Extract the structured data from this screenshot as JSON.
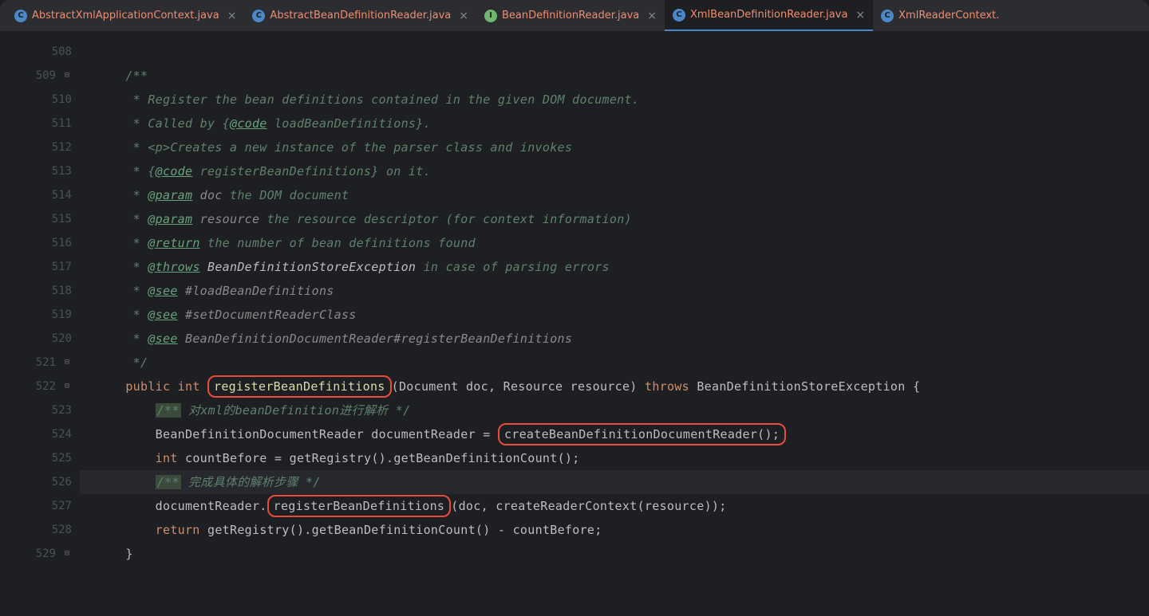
{
  "tabs": [
    {
      "icon": "C",
      "iconClass": "c",
      "label": "AbstractXmlApplicationContext.java",
      "active": false
    },
    {
      "icon": "C",
      "iconClass": "c",
      "label": "AbstractBeanDefinitionReader.java",
      "active": false
    },
    {
      "icon": "I",
      "iconClass": "i",
      "label": "BeanDefinitionReader.java",
      "active": false
    },
    {
      "icon": "C",
      "iconClass": "c",
      "label": "XmlBeanDefinitionReader.java",
      "active": true
    },
    {
      "icon": "C",
      "iconClass": "c",
      "label": "XmlReaderContext.",
      "active": false
    }
  ],
  "lineStart": 508,
  "lines": [
    {
      "n": 508,
      "content": ""
    },
    {
      "n": 509,
      "fold": "down",
      "content": "/**"
    },
    {
      "n": 510,
      "content": " * Register the bean definitions contained in the given DOM document."
    },
    {
      "n": 511,
      "content": " * Called by {@code loadBeanDefinitions}."
    },
    {
      "n": 512,
      "content": " * <p>Creates a new instance of the parser class and invokes"
    },
    {
      "n": 513,
      "content": " * {@code registerBeanDefinitions} on it."
    },
    {
      "n": 514,
      "content": " * @param doc the DOM document"
    },
    {
      "n": 515,
      "content": " * @param resource the resource descriptor (for context information)"
    },
    {
      "n": 516,
      "content": " * @return the number of bean definitions found"
    },
    {
      "n": 517,
      "content": " * @throws BeanDefinitionStoreException in case of parsing errors"
    },
    {
      "n": 518,
      "content": " * @see #loadBeanDefinitions"
    },
    {
      "n": 519,
      "content": " * @see #setDocumentReaderClass"
    },
    {
      "n": 520,
      "content": " * @see BeanDefinitionDocumentReader#registerBeanDefinitions"
    },
    {
      "n": 521,
      "fold": "up",
      "content": " */"
    },
    {
      "n": 522,
      "fold": "down",
      "content": "public int registerBeanDefinitions(Document doc, Resource resource) throws BeanDefinitionStoreException {"
    },
    {
      "n": 523,
      "content": "/** 对xml的beanDefinition进行解析 */"
    },
    {
      "n": 524,
      "content": "BeanDefinitionDocumentReader documentReader = createBeanDefinitionDocumentReader();"
    },
    {
      "n": 525,
      "content": "int countBefore = getRegistry().getBeanDefinitionCount();"
    },
    {
      "n": 526,
      "highlighted": true,
      "content": "/** 完成具体的解析步骤 */"
    },
    {
      "n": 527,
      "content": "documentReader.registerBeanDefinitions(doc, createReaderContext(resource));"
    },
    {
      "n": 528,
      "content": "return getRegistry().getBeanDefinitionCount() - countBefore;"
    },
    {
      "n": 529,
      "fold": "up",
      "content": "}"
    }
  ],
  "highlightedBoxes": [
    "registerBeanDefinitions",
    "createBeanDefinitionDocumentReader();",
    "registerBeanDefinitions"
  ],
  "comments": {
    "c523": "对xml的beanDefinition进行解析",
    "c526": "完成具体的解析步骤"
  },
  "javadoc": {
    "l510": "Register the bean definitions contained in the given DOM document.",
    "l511a": "Called by ",
    "l511b": "@code",
    "l511c": " loadBeanDefinitions",
    "l512": "<p>Creates a new instance of the parser class and invokes",
    "l513a": "@code",
    "l513b": " registerBeanDefinitions",
    "l513c": " on it.",
    "l514a": "@param",
    "l514b": "doc",
    "l514c": " the DOM document",
    "l515a": "@param",
    "l515b": "resource",
    "l515c": " the resource descriptor (for context information)",
    "l516a": "@return",
    "l516b": " the number of bean definitions found",
    "l517a": "@throws",
    "l517b": "BeanDefinitionStoreException",
    "l517c": " in case of parsing errors",
    "l518a": "@see",
    "l518b": " #loadBeanDefinitions",
    "l519a": "@see",
    "l519b": " #setDocumentReaderClass",
    "l520a": "@see",
    "l520b": " BeanDefinitionDocumentReader#registerBeanDefinitions"
  },
  "code": {
    "kw_public": "public",
    "kw_int": "int",
    "method_rbd": "registerBeanDefinitions",
    "type_doc": "Document",
    "param_doc": "doc",
    "type_res": "Resource",
    "param_res": "resource",
    "kw_throws": "throws",
    "type_ex": "BeanDefinitionStoreException",
    "type_bddr": "BeanDefinitionDocumentReader",
    "var_dr": "documentReader",
    "method_create": "createBeanDefinitionDocumentReader();",
    "var_cb": "countBefore",
    "method_getreg": "getRegistry",
    "method_getcount": "getBeanDefinitionCount",
    "method_crcontext": "createReaderContext",
    "kw_return": "return"
  }
}
